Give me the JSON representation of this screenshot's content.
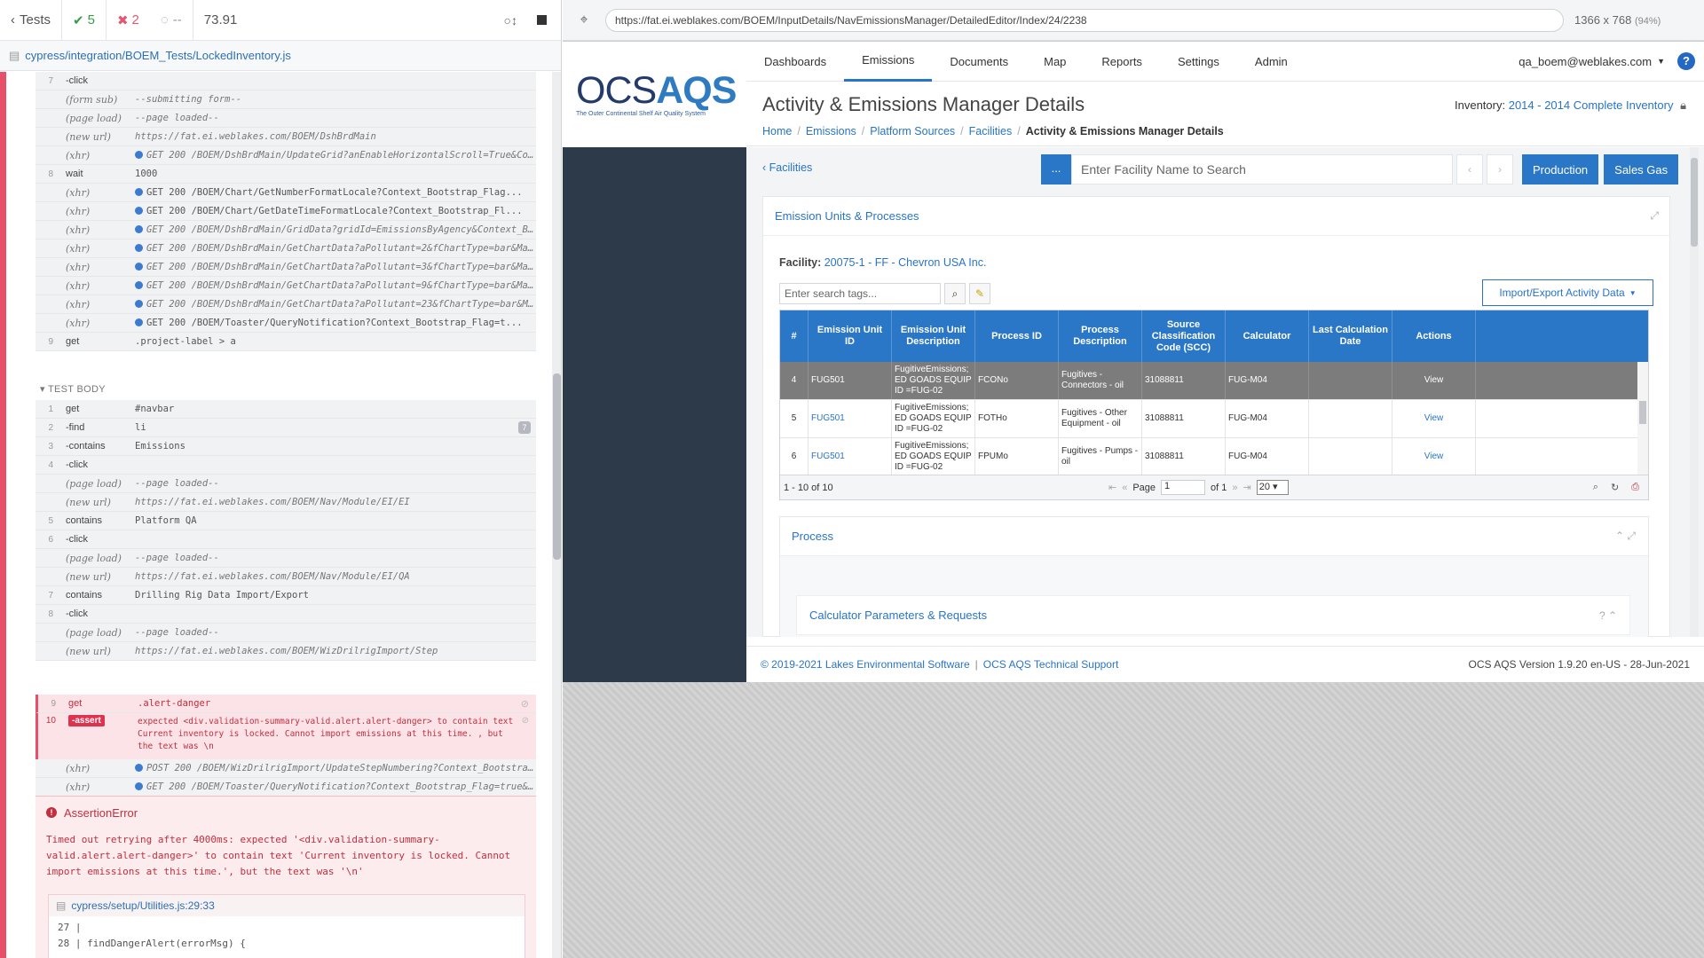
{
  "runner": {
    "back_label": "Tests",
    "passed": "5",
    "failed": "2",
    "pending": "--",
    "duration": "73.91",
    "spec_path": "cypress/integration/BOEM_Tests/LockedInventory.js",
    "before_rows": [
      {
        "num": "7",
        "name": "-click",
        "sub": false,
        "msg": "",
        "dot": false,
        "italic": false
      },
      {
        "num": "",
        "name": "(form sub)",
        "sub": true,
        "msg": "--submitting form--",
        "dot": false,
        "italic": true
      },
      {
        "num": "",
        "name": "(page load)",
        "sub": true,
        "msg": "--page loaded--",
        "dot": false,
        "italic": true
      },
      {
        "num": "",
        "name": "(new url)",
        "sub": true,
        "msg": "https://fat.ei.weblakes.com/BOEM/DshBrdMain",
        "dot": false,
        "italic": true
      },
      {
        "num": "",
        "name": "(xhr)",
        "sub": true,
        "msg": "GET 200 /BOEM/DshBrdMain/UpdateGrid?anEnableHorizontalScroll=True&Context_Bo...",
        "dot": true,
        "italic": true
      },
      {
        "num": "8",
        "name": "wait",
        "sub": false,
        "msg": "1000",
        "dot": false,
        "italic": false
      },
      {
        "num": "",
        "name": "(xhr)",
        "sub": true,
        "msg": "GET 200 /BOEM/Chart/GetNumberFormatLocale?Context_Bootstrap_Flag...",
        "dot": true,
        "italic": false
      },
      {
        "num": "",
        "name": "(xhr)",
        "sub": true,
        "msg": "GET 200 /BOEM/Chart/GetDateTimeFormatLocale?Context_Bootstrap_Fl...",
        "dot": true,
        "italic": false
      },
      {
        "num": "",
        "name": "(xhr)",
        "sub": true,
        "msg": "GET 200 /BOEM/DshBrdMain/GridData?gridId=EmissionsByAgency&Context_Bootstrap...",
        "dot": true,
        "italic": true
      },
      {
        "num": "",
        "name": "(xhr)",
        "sub": true,
        "msg": "GET 200 /BOEM/DshBrdMain/GetChartData?aPollutant=2&fChartType=bar&MaxLegendE...",
        "dot": true,
        "italic": true
      },
      {
        "num": "",
        "name": "(xhr)",
        "sub": true,
        "msg": "GET 200 /BOEM/DshBrdMain/GetChartData?aPollutant=3&fChartType=bar&MaxLegendE...",
        "dot": true,
        "italic": true
      },
      {
        "num": "",
        "name": "(xhr)",
        "sub": true,
        "msg": "GET 200 /BOEM/DshBrdMain/GetChartData?aPollutant=9&fChartType=bar&MaxLegendE...",
        "dot": true,
        "italic": true
      },
      {
        "num": "",
        "name": "(xhr)",
        "sub": true,
        "msg": "GET 200 /BOEM/DshBrdMain/GetChartData?aPollutant=23&fChartType=bar&MaxLegendE...",
        "dot": true,
        "italic": true
      },
      {
        "num": "",
        "name": "(xhr)",
        "sub": true,
        "msg": "GET 200 /BOEM/Toaster/QueryNotification?Context_Bootstrap_Flag=t...",
        "dot": true,
        "italic": false
      },
      {
        "num": "9",
        "name": "get",
        "sub": false,
        "msg": ".project-label > a",
        "dot": false,
        "italic": false
      }
    ],
    "test_body_label": "TEST BODY",
    "body_rows": [
      {
        "num": "1",
        "name": "get",
        "sub": false,
        "msg": "#navbar",
        "dot": false,
        "italic": false
      },
      {
        "num": "2",
        "name": "-find",
        "sub": false,
        "msg": "li",
        "dot": false,
        "italic": false,
        "badge": "7"
      },
      {
        "num": "3",
        "name": "-contains",
        "sub": false,
        "msg": "Emissions",
        "dot": false,
        "italic": false
      },
      {
        "num": "4",
        "name": "-click",
        "sub": false,
        "msg": "",
        "dot": false,
        "italic": false
      },
      {
        "num": "",
        "name": "(page load)",
        "sub": true,
        "msg": "--page loaded--",
        "dot": false,
        "italic": true
      },
      {
        "num": "",
        "name": "(new url)",
        "sub": true,
        "msg": "https://fat.ei.weblakes.com/BOEM/Nav/Module/EI/EI",
        "dot": false,
        "italic": true
      },
      {
        "num": "5",
        "name": "contains",
        "sub": false,
        "msg": "Platform QA",
        "dot": false,
        "italic": false
      },
      {
        "num": "6",
        "name": "-click",
        "sub": false,
        "msg": "",
        "dot": false,
        "italic": false
      },
      {
        "num": "",
        "name": "(page load)",
        "sub": true,
        "msg": "--page loaded--",
        "dot": false,
        "italic": true
      },
      {
        "num": "",
        "name": "(new url)",
        "sub": true,
        "msg": "https://fat.ei.weblakes.com/BOEM/Nav/Module/EI/QA",
        "dot": false,
        "italic": true
      },
      {
        "num": "7",
        "name": "contains",
        "sub": false,
        "msg": "Drilling Rig Data Import/Export",
        "dot": false,
        "italic": false
      },
      {
        "num": "8",
        "name": "-click",
        "sub": false,
        "msg": "",
        "dot": false,
        "italic": false
      },
      {
        "num": "",
        "name": "(page load)",
        "sub": true,
        "msg": "--page loaded--",
        "dot": false,
        "italic": true
      },
      {
        "num": "",
        "name": "(new url)",
        "sub": true,
        "msg": "https://fat.ei.weblakes.com/BOEM/WizDrilrigImport/Step",
        "dot": false,
        "italic": true
      }
    ],
    "get_danger": {
      "num": "9",
      "name": "get",
      "msg": ".alert-danger"
    },
    "assert_row": {
      "num": "10",
      "name": "-assert",
      "line1": "expected <div.validation-summary-valid.alert.alert-danger> to contain text",
      "line2": "Current inventory is locked. Cannot import emissions at this time. , but",
      "line3": "the text was \\n"
    },
    "after_rows": [
      {
        "num": "",
        "name": "(xhr)",
        "sub": true,
        "msg": "POST 200 /BOEM/WizDrilrigImport/UpdateStepNumbering?Context_Bootstrap_Flag=...",
        "dot": true,
        "italic": true
      },
      {
        "num": "",
        "name": "(xhr)",
        "sub": true,
        "msg": "GET 200 /BOEM/Toaster/QueryNotification?Context_Bootstrap_Flag=true&WizUniqu...",
        "dot": true,
        "italic": true
      }
    ],
    "error": {
      "title": "AssertionError",
      "message": "Timed out retrying after 4000ms: expected '<div.validation-summary-valid.alert.alert-danger>' to contain text 'Current inventory is locked. Cannot import emissions at this time.', but the text was '\\n'",
      "stack_file": "cypress/setup/Utilities.js:29:33",
      "code_lines": [
        "27 |",
        "28 |     findDangerAlert(errorMsg) {"
      ]
    }
  },
  "browser": {
    "url": "https://fat.ei.weblakes.com/BOEM/InputDetails/NavEmissionsManager/DetailedEditor/Index/24/2238",
    "viewport": "1366 x 768",
    "zoom": "(94%)"
  },
  "app": {
    "logo_ocs": "OCS",
    "logo_aqs": "AQS",
    "logo_tagline": "The Outer Continental Shelf Air Quality System",
    "nav": [
      "Dashboards",
      "Emissions",
      "Documents",
      "Map",
      "Reports",
      "Settings",
      "Admin"
    ],
    "active_nav": "Emissions",
    "user": "qa_boem@weblakes.com",
    "help": "?",
    "page_title": "Activity & Emissions Manager Details",
    "inventory_label": "Inventory:",
    "inventory_value": "2014 - 2014 Complete Inventory",
    "breadcrumb": [
      "Home",
      "Emissions",
      "Platform Sources",
      "Facilities"
    ],
    "breadcrumb_current": "Activity & Emissions Manager Details",
    "back_link": "Facilities",
    "search_dots": "...",
    "search_placeholder": "Enter Facility Name to Search",
    "production_btn": "Production",
    "salesgas_btn": "Sales Gas",
    "card_title": "Emission Units & Processes",
    "facility_label": "Facility:",
    "facility_value": "20075-1 - FF - Chevron USA Inc.",
    "tags_placeholder": "Enter search tags...",
    "import_btn": "Import/Export Activity Data",
    "grid": {
      "columns": [
        "#",
        "Emission Unit ID",
        "Emission Unit Description",
        "Process ID",
        "Process Description",
        "Source Classification Code (SCC)",
        "Calculator",
        "Last Calculation Date",
        "Actions"
      ],
      "rows": [
        {
          "n": "4",
          "unit": "FUG501",
          "desc": "FugitiveEmissions; ED GOADS EQUIP ID =FUG-02",
          "pid": "FCONo",
          "pdesc": "Fugitives - Connectors - oil",
          "scc": "31088811",
          "calc": "FUG-M04",
          "date": "",
          "action": "View",
          "selected": true
        },
        {
          "n": "5",
          "unit": "FUG501",
          "desc": "FugitiveEmissions; ED GOADS EQUIP ID =FUG-02",
          "pid": "FOTHo",
          "pdesc": "Fugitives - Other Equipment - oil",
          "scc": "31088811",
          "calc": "FUG-M04",
          "date": "",
          "action": "View",
          "selected": false
        },
        {
          "n": "6",
          "unit": "FUG501",
          "desc": "FugitiveEmissions; ED GOADS EQUIP ID =FUG-02",
          "pid": "FPUMo",
          "pdesc": "Fugitives - Pumps - oil",
          "scc": "31088811",
          "calc": "FUG-M04",
          "date": "",
          "action": "View",
          "selected": false
        }
      ],
      "range": "1 - 10 of 10",
      "page_label": "Page",
      "page_value": "1",
      "of_label": "of 1",
      "page_size": "20"
    },
    "process_title": "Process",
    "calc_title": "Calculator Parameters & Requests",
    "footer_copy": "© 2019-2021 Lakes Environmental Software",
    "footer_sep": "|",
    "footer_support": "OCS AQS Technical Support",
    "footer_version": "OCS AQS Version 1.9.20 en-US - 28-Jun-2021"
  }
}
